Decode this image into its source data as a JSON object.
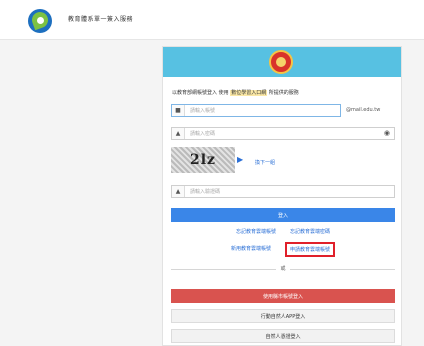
{
  "header": {
    "site_title": "教育體系單一簽入服務",
    "logo_icon": "moe-logo-icon"
  },
  "login": {
    "intro_before": "以教育部網帳號登入 使用",
    "intro_highlight": "數位學習入口網",
    "intro_after": "所提供的服務",
    "account_placeholder": "請輸入帳號",
    "account_suffix": "@mail.edu.tw",
    "password_placeholder": "請輸入密碼",
    "captcha_text": "2lz",
    "refresh_label": "換下一組",
    "code_placeholder": "請輸入驗證碼",
    "login_button": "登入",
    "forgot_account": "忘記教育雲端帳號",
    "forgot_password": "忘記教育雲端密碼",
    "register_account": "新用教育雲端帳號",
    "apply_account": "申請教育雲端帳號",
    "or_label": "或",
    "teacher_login": "使用縣市帳號登入",
    "app_login": "行動自然人APP登入",
    "cert_login": "自然人憑證登入"
  },
  "colors": {
    "header_band": "#57c1e2",
    "primary": "#3a86e8",
    "danger": "#d9534f",
    "highlight_box": "#e0202a"
  }
}
